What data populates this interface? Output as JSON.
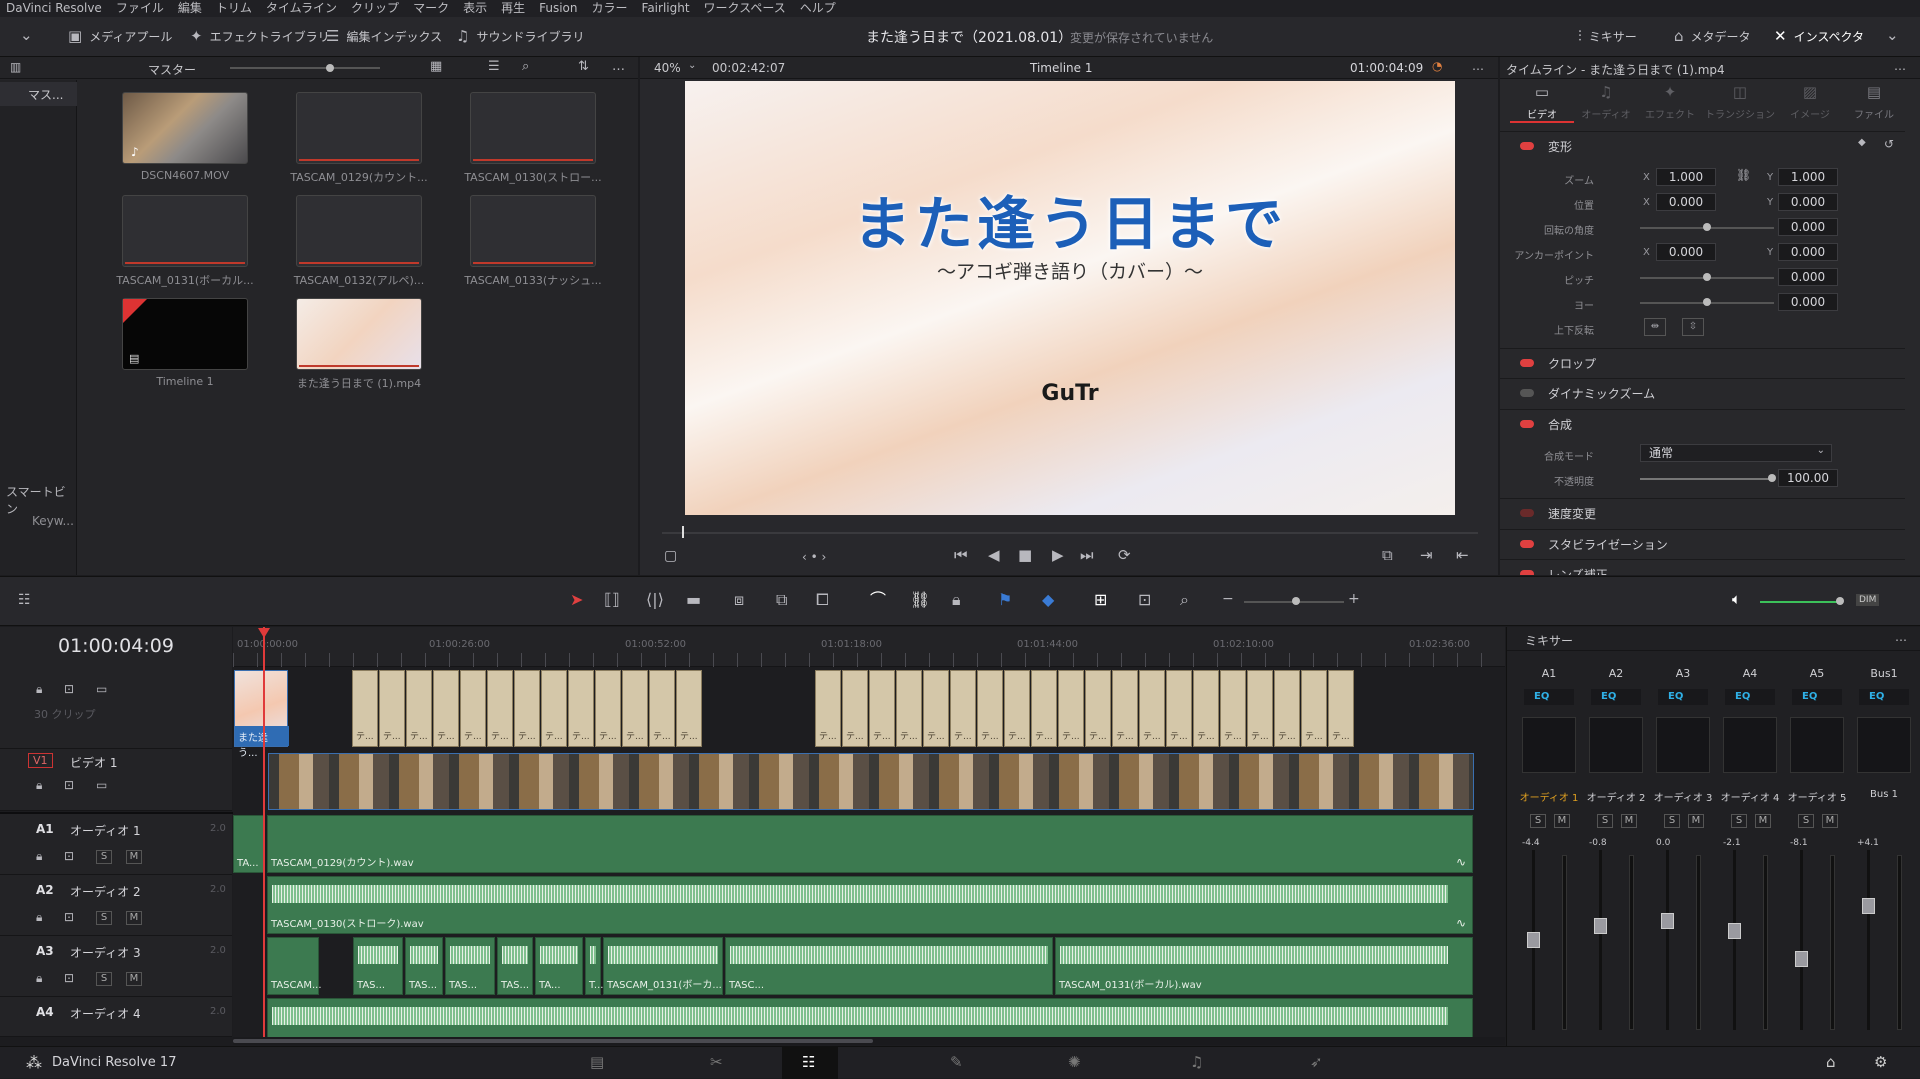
{
  "menu": [
    "DaVinci Resolve",
    "ファイル",
    "編集",
    "トリム",
    "タイムライン",
    "クリップ",
    "マーク",
    "表示",
    "再生",
    "Fusion",
    "カラー",
    "Fairlight",
    "ワークスペース",
    "ヘルプ"
  ],
  "toolbar": {
    "media_pool": "メディアプール",
    "effects": "エフェクトライブラリ",
    "edit_index": "編集インデックス",
    "sound_library": "サウンドライブラリ",
    "project_title": "また逢う日まで（2021.08.01）",
    "unsaved": "変更が保存されていません",
    "mixer": "ミキサー",
    "metadata": "メタデータ",
    "inspector": "インスペクタ"
  },
  "media": {
    "bin": "マスター",
    "sidebar": [
      "マス...",
      "スマートビン",
      "Keyw..."
    ],
    "items": [
      "DSCN4607.MOV",
      "TASCAM_0129(カウント...",
      "TASCAM_0130(ストロー...",
      "TASCAM_0131(ボーカル...",
      "TASCAM_0132(アルペ)...",
      "TASCAM_0133(ナッシュ...",
      "Timeline 1",
      "また逢う日まで (1).mp4"
    ]
  },
  "viewer": {
    "zoom": "40%",
    "duration": "00:02:42:07",
    "timeline": "Timeline 1",
    "timecode": "01:00:04:09",
    "title": "また逢う日まで",
    "subtitle": "～アコギ弾き語り（カバー）～",
    "author": "GuTr"
  },
  "inspector": {
    "header": "タイムライン - また逢う日まで (1).mp4",
    "tabs": [
      "ビデオ",
      "オーディオ",
      "エフェクト",
      "トランジション",
      "イメージ",
      "ファイル"
    ],
    "transform": "変形",
    "zoom": "ズーム",
    "x": "X",
    "y": "Y",
    "zoom_x": "1.000",
    "zoom_y": "1.000",
    "position": "位置",
    "pos_x": "0.000",
    "pos_y": "0.000",
    "rotation": "回転の角度",
    "rot_val": "0.000",
    "anchor": "アンカーポイント",
    "anchor_x": "0.000",
    "anchor_y": "0.000",
    "pitch": "ピッチ",
    "pitch_val": "0.000",
    "yaw": "ヨー",
    "yaw_val": "0.000",
    "flip": "上下反転",
    "crop": "クロップ",
    "dynzoom": "ダイナミックズーム",
    "composite": "合成",
    "blend_mode": "合成モード",
    "blend_val": "通常",
    "opacity": "不透明度",
    "opacity_val": "100.00",
    "speed": "速度変更",
    "stabilize": "スタビライゼーション",
    "lens": "レンズ補正"
  },
  "timeline": {
    "timecode": "01:00:04:09",
    "ruler": [
      "01:00:00:00",
      "01:00:26:00",
      "01:00:52:00",
      "01:01:18:00",
      "01:01:44:00",
      "01:02:10:00",
      "01:02:36:00"
    ],
    "clips_count": "30 クリップ",
    "v1": "V1",
    "v1_name": "ビデオ 1",
    "title_clip": "また逢う...",
    "audio": [
      {
        "id": "A1",
        "name": "オーディオ 1",
        "ch": "2.0",
        "clip": "TASCAM_0129(カウント).wav"
      },
      {
        "id": "A2",
        "name": "オーディオ 2",
        "ch": "2.0",
        "clip": "TASCAM_0130(ストローク).wav"
      },
      {
        "id": "A3",
        "name": "オーディオ 3",
        "ch": "2.0",
        "clip": "TASCAM_0131(ボーカル).wav"
      },
      {
        "id": "A4",
        "name": "オーディオ 4",
        "ch": "2.0",
        "clip": ""
      }
    ],
    "a1_small": "TA...",
    "a3_small": [
      "TASCAM...",
      "TAS...",
      "TAS...",
      "TAS...",
      "TAS...",
      "TA...",
      "T...",
      "TASCAM_0131(ボーカ...",
      "TASC..."
    ],
    "text_clip": "テ..."
  },
  "mixer": {
    "title": "ミキサー",
    "channels": [
      {
        "id": "A1",
        "name": "オーディオ 1",
        "db": "-4.4"
      },
      {
        "id": "A2",
        "name": "オーディオ 2",
        "db": "-0.8"
      },
      {
        "id": "A3",
        "name": "オーディオ 3",
        "db": "0.0"
      },
      {
        "id": "A4",
        "name": "オーディオ 4",
        "db": "-2.1"
      },
      {
        "id": "A5",
        "name": "オーディオ 5",
        "db": "-8.1"
      },
      {
        "id": "Bus1",
        "name": "Bus 1",
        "db": "+4.1"
      }
    ],
    "eq": "EQ",
    "s": "S",
    "m": "M",
    "dim": "DIM"
  },
  "footer": {
    "app": "DaVinci Resolve 17"
  }
}
